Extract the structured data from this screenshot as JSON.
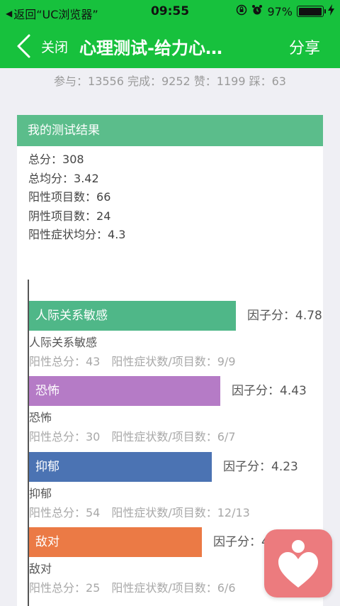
{
  "status_bar": {
    "back_label": "返回“UC浏览器”",
    "time": "09:55",
    "battery_text": "97%",
    "battery_level": 0.97
  },
  "nav": {
    "close_label": "关闭",
    "title": "心理测试-给力心…",
    "share_label": "分享"
  },
  "stats": {
    "text": "参与：13556 完成：9252 赞：1199 踩：63"
  },
  "result": {
    "header": "我的测试结果",
    "summary": [
      {
        "label": "总分：",
        "value": "308"
      },
      {
        "label": "总均分：",
        "value": "3.42"
      },
      {
        "label": "阳性项目数：",
        "value": "66"
      },
      {
        "label": "阴性项目数：",
        "value": "24"
      },
      {
        "label": "阳性症状均分：",
        "value": "4.3"
      }
    ],
    "factors": [
      {
        "name": "人际关系敏感",
        "score_text": "因子分：4.78",
        "score": 4.78,
        "color": "#4fb788",
        "detail": "阳性总分：43　阳性症状数/项目数：9/9"
      },
      {
        "name": "恐怖",
        "score_text": "因子分：4.43",
        "score": 4.43,
        "color": "#b57bc6",
        "detail": "阳性总分：30　阳性症状数/项目数：6/7"
      },
      {
        "name": "抑郁",
        "score_text": "因子分：4.23",
        "score": 4.23,
        "color": "#4b73b3",
        "detail": "阳性总分：54　阳性症状数/项目数：12/13"
      },
      {
        "name": "敌对",
        "score_text": "因子分：4",
        "score": 4.0,
        "color": "#eb7a45",
        "detail": "阳性总分：25　阳性症状数/项目数：6/6"
      }
    ]
  },
  "icons": {
    "back": "chevron-left-icon",
    "lock": "orientation-lock-icon",
    "alarm": "alarm-icon",
    "charging": "charging-bolt-icon",
    "floating": "heart-person-app-icon"
  }
}
